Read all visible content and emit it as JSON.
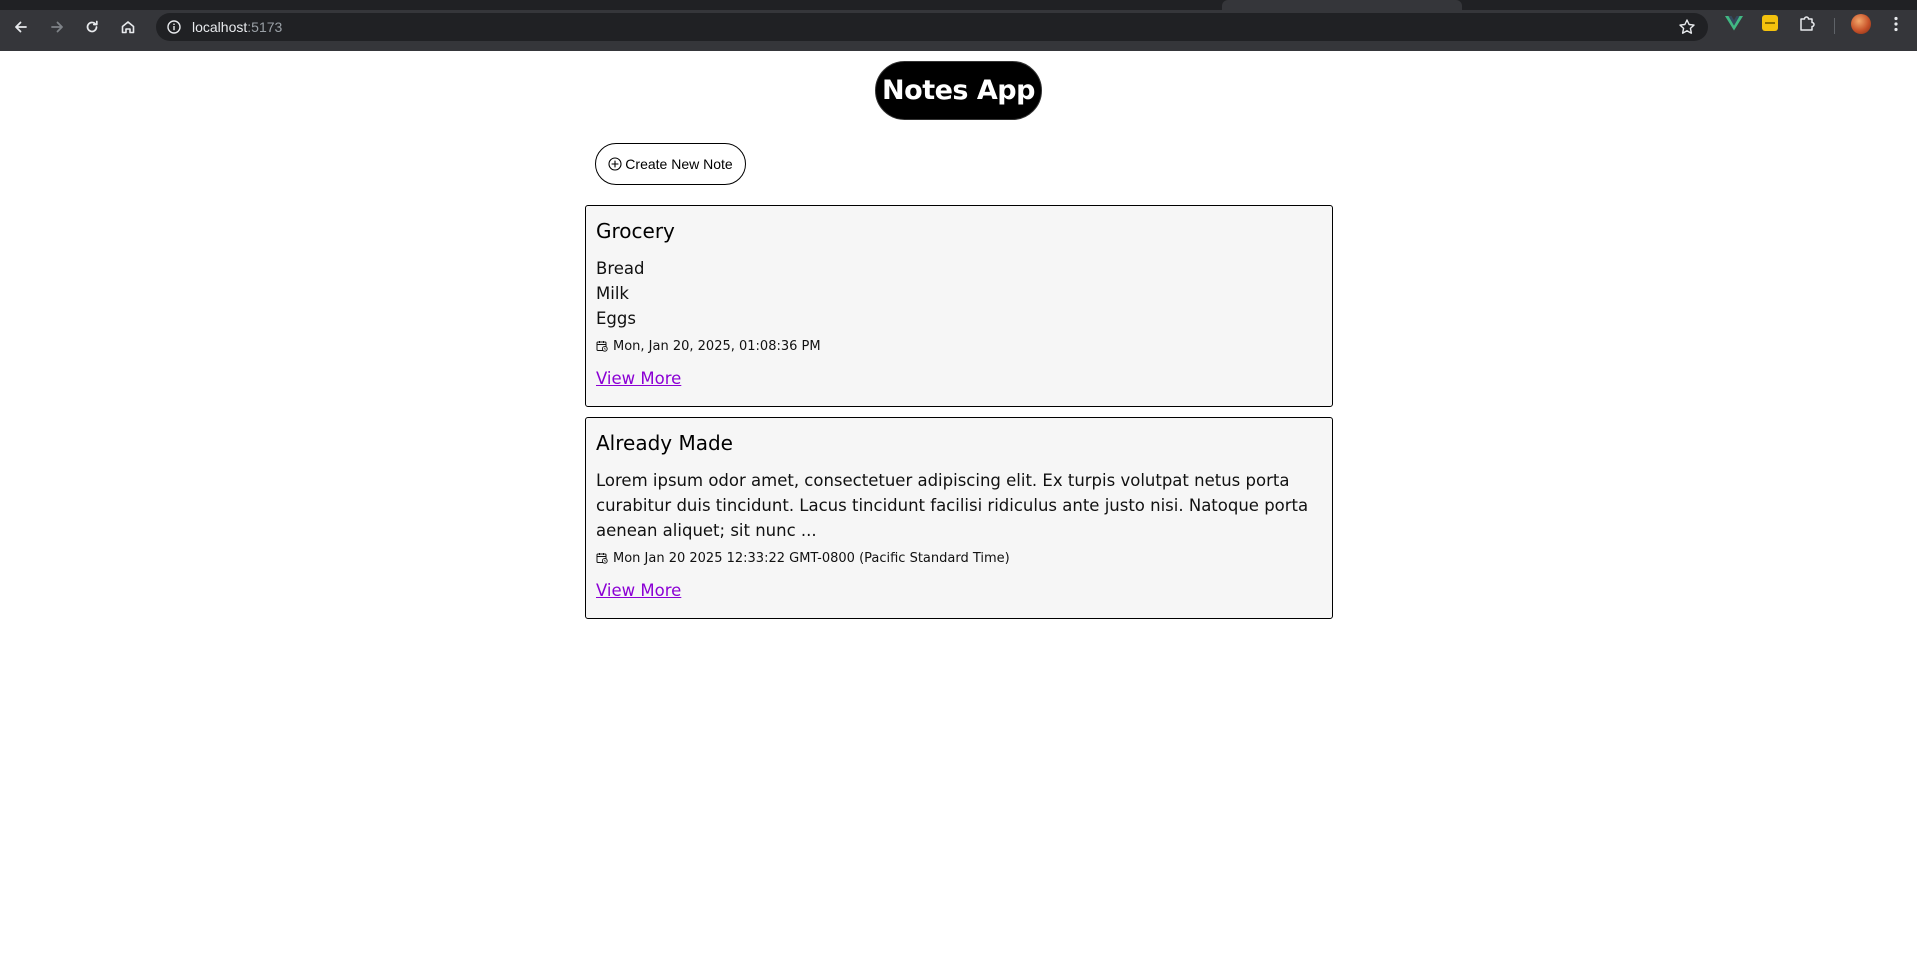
{
  "browser": {
    "url_host": "localhost",
    "url_port": ":5173",
    "icons": [
      "back-arrow-icon",
      "forward-arrow-icon",
      "reload-icon",
      "home-icon",
      "site-info-icon",
      "star-icon",
      "vue-devtools-icon",
      "extension-yellow-icon",
      "puzzle-extensions-icon",
      "profile-avatar"
    ]
  },
  "app": {
    "title": "Notes App",
    "create_button_label": "Create New Note"
  },
  "notes": [
    {
      "title": "Grocery",
      "lines": [
        "Bread",
        "Milk",
        "Eggs"
      ],
      "date": "Mon, Jan 20, 2025, 01:08:36 PM",
      "link_label": "View More"
    },
    {
      "title": "Already Made",
      "body": "Lorem ipsum odor amet, consectetuer adipiscing elit. Ex turpis volutpat netus porta curabitur duis tincidunt. Lacus tincidunt facilisi ridiculus ante justo nisi. Natoque porta aenean aliquet; sit nunc ...",
      "date": "Mon Jan 20 2025 12:33:22 GMT-0800 (Pacific Standard Time)",
      "link_label": "View More"
    }
  ],
  "colors": {
    "chrome_bg": "#35363a",
    "omnibox_bg": "#202124",
    "link": "#8b00d4",
    "card_bg": "#f6f6f6"
  }
}
